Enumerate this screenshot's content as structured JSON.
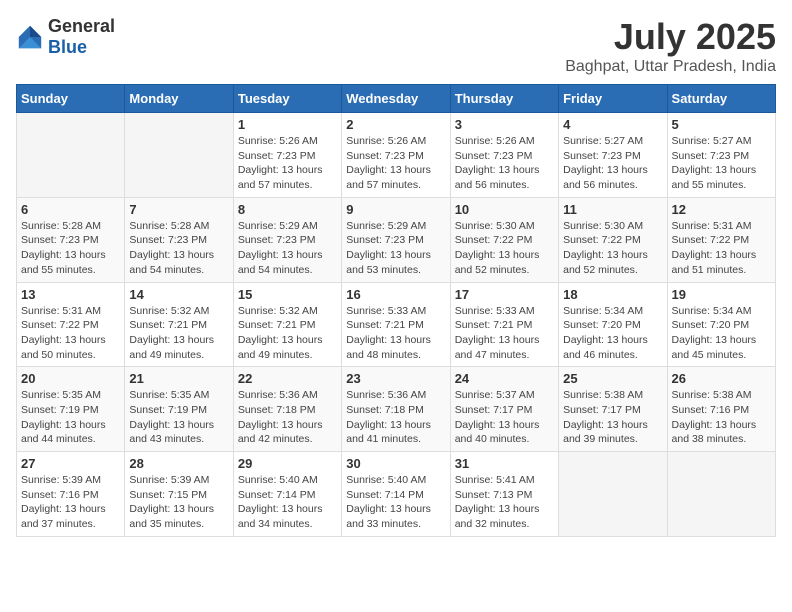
{
  "logo": {
    "text_general": "General",
    "text_blue": "Blue"
  },
  "header": {
    "month_year": "July 2025",
    "location": "Baghpat, Uttar Pradesh, India"
  },
  "weekdays": [
    "Sunday",
    "Monday",
    "Tuesday",
    "Wednesday",
    "Thursday",
    "Friday",
    "Saturday"
  ],
  "weeks": [
    [
      {
        "day": "",
        "info": ""
      },
      {
        "day": "",
        "info": ""
      },
      {
        "day": "1",
        "info": "Sunrise: 5:26 AM\nSunset: 7:23 PM\nDaylight: 13 hours and 57 minutes."
      },
      {
        "day": "2",
        "info": "Sunrise: 5:26 AM\nSunset: 7:23 PM\nDaylight: 13 hours and 57 minutes."
      },
      {
        "day": "3",
        "info": "Sunrise: 5:26 AM\nSunset: 7:23 PM\nDaylight: 13 hours and 56 minutes."
      },
      {
        "day": "4",
        "info": "Sunrise: 5:27 AM\nSunset: 7:23 PM\nDaylight: 13 hours and 56 minutes."
      },
      {
        "day": "5",
        "info": "Sunrise: 5:27 AM\nSunset: 7:23 PM\nDaylight: 13 hours and 55 minutes."
      }
    ],
    [
      {
        "day": "6",
        "info": "Sunrise: 5:28 AM\nSunset: 7:23 PM\nDaylight: 13 hours and 55 minutes."
      },
      {
        "day": "7",
        "info": "Sunrise: 5:28 AM\nSunset: 7:23 PM\nDaylight: 13 hours and 54 minutes."
      },
      {
        "day": "8",
        "info": "Sunrise: 5:29 AM\nSunset: 7:23 PM\nDaylight: 13 hours and 54 minutes."
      },
      {
        "day": "9",
        "info": "Sunrise: 5:29 AM\nSunset: 7:23 PM\nDaylight: 13 hours and 53 minutes."
      },
      {
        "day": "10",
        "info": "Sunrise: 5:30 AM\nSunset: 7:22 PM\nDaylight: 13 hours and 52 minutes."
      },
      {
        "day": "11",
        "info": "Sunrise: 5:30 AM\nSunset: 7:22 PM\nDaylight: 13 hours and 52 minutes."
      },
      {
        "day": "12",
        "info": "Sunrise: 5:31 AM\nSunset: 7:22 PM\nDaylight: 13 hours and 51 minutes."
      }
    ],
    [
      {
        "day": "13",
        "info": "Sunrise: 5:31 AM\nSunset: 7:22 PM\nDaylight: 13 hours and 50 minutes."
      },
      {
        "day": "14",
        "info": "Sunrise: 5:32 AM\nSunset: 7:21 PM\nDaylight: 13 hours and 49 minutes."
      },
      {
        "day": "15",
        "info": "Sunrise: 5:32 AM\nSunset: 7:21 PM\nDaylight: 13 hours and 49 minutes."
      },
      {
        "day": "16",
        "info": "Sunrise: 5:33 AM\nSunset: 7:21 PM\nDaylight: 13 hours and 48 minutes."
      },
      {
        "day": "17",
        "info": "Sunrise: 5:33 AM\nSunset: 7:21 PM\nDaylight: 13 hours and 47 minutes."
      },
      {
        "day": "18",
        "info": "Sunrise: 5:34 AM\nSunset: 7:20 PM\nDaylight: 13 hours and 46 minutes."
      },
      {
        "day": "19",
        "info": "Sunrise: 5:34 AM\nSunset: 7:20 PM\nDaylight: 13 hours and 45 minutes."
      }
    ],
    [
      {
        "day": "20",
        "info": "Sunrise: 5:35 AM\nSunset: 7:19 PM\nDaylight: 13 hours and 44 minutes."
      },
      {
        "day": "21",
        "info": "Sunrise: 5:35 AM\nSunset: 7:19 PM\nDaylight: 13 hours and 43 minutes."
      },
      {
        "day": "22",
        "info": "Sunrise: 5:36 AM\nSunset: 7:18 PM\nDaylight: 13 hours and 42 minutes."
      },
      {
        "day": "23",
        "info": "Sunrise: 5:36 AM\nSunset: 7:18 PM\nDaylight: 13 hours and 41 minutes."
      },
      {
        "day": "24",
        "info": "Sunrise: 5:37 AM\nSunset: 7:17 PM\nDaylight: 13 hours and 40 minutes."
      },
      {
        "day": "25",
        "info": "Sunrise: 5:38 AM\nSunset: 7:17 PM\nDaylight: 13 hours and 39 minutes."
      },
      {
        "day": "26",
        "info": "Sunrise: 5:38 AM\nSunset: 7:16 PM\nDaylight: 13 hours and 38 minutes."
      }
    ],
    [
      {
        "day": "27",
        "info": "Sunrise: 5:39 AM\nSunset: 7:16 PM\nDaylight: 13 hours and 37 minutes."
      },
      {
        "day": "28",
        "info": "Sunrise: 5:39 AM\nSunset: 7:15 PM\nDaylight: 13 hours and 35 minutes."
      },
      {
        "day": "29",
        "info": "Sunrise: 5:40 AM\nSunset: 7:14 PM\nDaylight: 13 hours and 34 minutes."
      },
      {
        "day": "30",
        "info": "Sunrise: 5:40 AM\nSunset: 7:14 PM\nDaylight: 13 hours and 33 minutes."
      },
      {
        "day": "31",
        "info": "Sunrise: 5:41 AM\nSunset: 7:13 PM\nDaylight: 13 hours and 32 minutes."
      },
      {
        "day": "",
        "info": ""
      },
      {
        "day": "",
        "info": ""
      }
    ]
  ]
}
